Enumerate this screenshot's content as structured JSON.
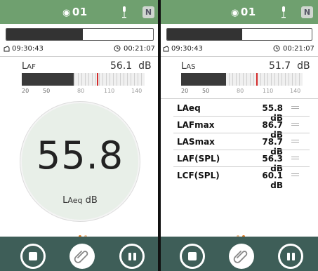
{
  "colors": {
    "statusbar": "#6fa06f",
    "toolbar": "#3e5e58",
    "peak": "#d42a2a",
    "dots": "#e07a20"
  },
  "left": {
    "status": {
      "number": "01",
      "badge": "N"
    },
    "progress_fraction": 0.52,
    "record_time": "09:30:43",
    "elapsed_time": "00:21:07",
    "meter": {
      "label_main": "L",
      "label_sub": "AF",
      "value": "56.1",
      "unit": "dB",
      "level_fraction": 0.42,
      "peak_fraction": 0.61
    },
    "ticks": [
      "20",
      "50",
      "80",
      "110",
      "140"
    ],
    "big": {
      "value": "55.8",
      "unit_prefix": "L",
      "unit_sub": "Aeq",
      "unit": "dB"
    },
    "page_indicator": "2 pages"
  },
  "right": {
    "status": {
      "number": "01",
      "badge": "N"
    },
    "progress_fraction": 0.52,
    "record_time": "09:30:43",
    "elapsed_time": "00:21:07",
    "meter": {
      "label_main": "L",
      "label_sub": "AS",
      "value": "51.7",
      "unit": "dB",
      "level_fraction": 0.37,
      "peak_fraction": 0.62
    },
    "ticks": [
      "20",
      "50",
      "80",
      "110",
      "140"
    ],
    "list": [
      {
        "name": "LAeq",
        "value": "55.8 dB"
      },
      {
        "name": "LAFmax",
        "value": "86.7 dB"
      },
      {
        "name": "LASmax",
        "value": "78.7 dB"
      },
      {
        "name": "LAF(SPL)",
        "value": "56.3 dB"
      },
      {
        "name": "LCF(SPL)",
        "value": "60.1 dB"
      }
    ]
  },
  "icons": [
    "stop-icon",
    "paperclip-icon",
    "pause-icon",
    "microphone-icon",
    "clock-icon",
    "record-icon"
  ]
}
